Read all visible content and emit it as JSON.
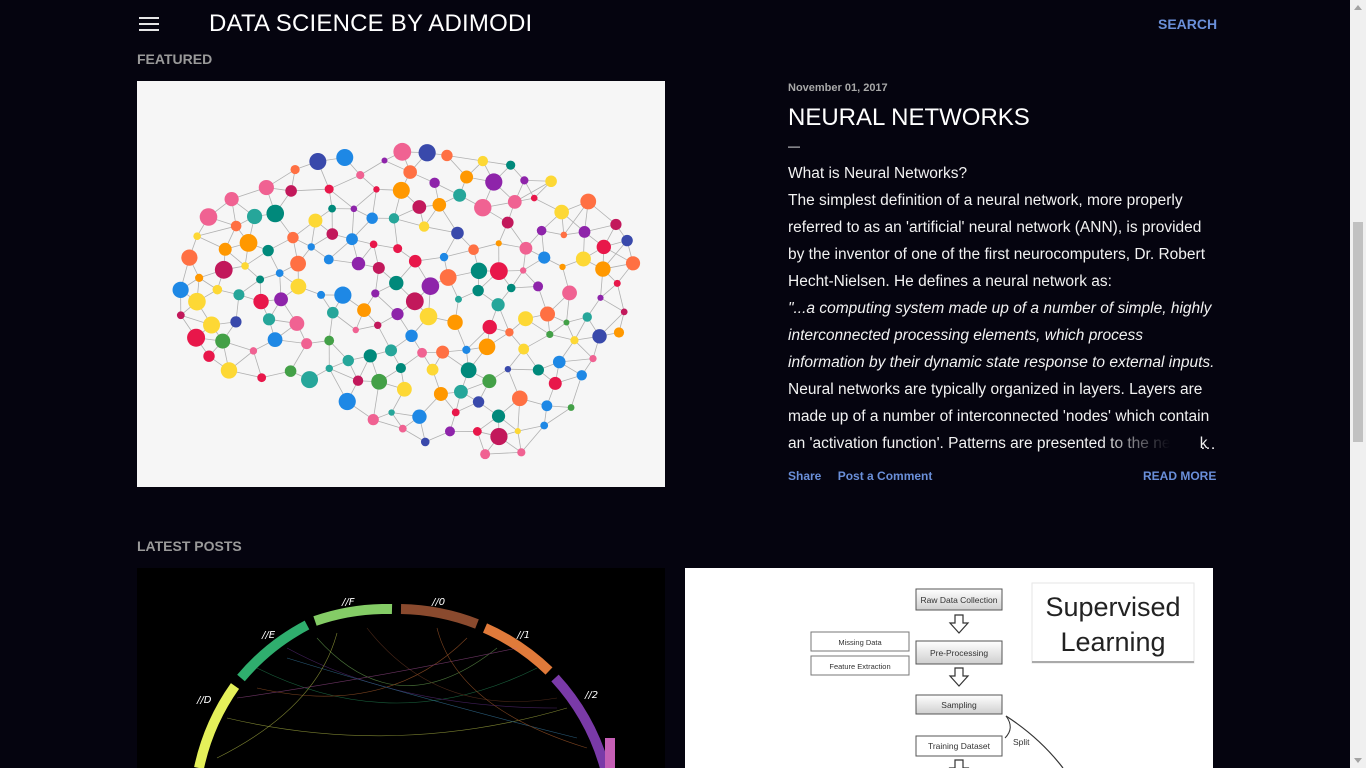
{
  "header": {
    "site_title": "DATA SCIENCE BY ADIMODI",
    "search_label": "SEARCH"
  },
  "featured": {
    "section_label": "FEATURED",
    "post": {
      "date": "November 01, 2017",
      "title": "NEURAL NETWORKS",
      "dash": "—",
      "subheading": "What is Neural Networks?",
      "body_intro": "The simplest definition of a neural network, more properly referred to as an 'artificial' neural network (ANN), is provided by the inventor of one of the first neurocomputers, Dr. Robert Hecht-Nielsen. He defines a neural network as:",
      "quote": "\"...a computing system made up of a number of simple, highly interconnected processing elements, which process information by their dynamic state response to external inputs.",
      "body_after": " Neural networks are typically organized in layers. Layers are made up of a number of interconnected 'nodes' which contain an 'activation function'. Patterns are presented to the network",
      "ellipsis": "…",
      "share_label": "Share",
      "comment_label": "Post a Comment",
      "read_more_label": "READ MORE"
    }
  },
  "latest": {
    "section_label": "LATEST POSTS",
    "chord_labels": [
      "//D",
      "//E",
      "//F",
      "//0",
      "//1",
      "//2"
    ],
    "flowchart": {
      "steps": [
        "Raw Data Collection",
        "Pre-Processing",
        "Sampling",
        "Training Dataset"
      ],
      "side_boxes": [
        "Missing Data",
        "Feature Extraction"
      ],
      "split_label": "Split",
      "title_line1": "Supervised",
      "title_line2": "Learning"
    }
  },
  "colors": {
    "background": "#05040f",
    "link": "#6a8fd9",
    "muted": "#9a9a9a"
  },
  "icons": [
    "hamburger-menu-icon"
  ]
}
